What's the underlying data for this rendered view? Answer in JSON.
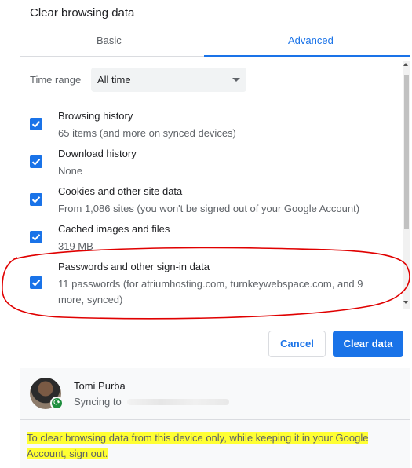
{
  "dialog": {
    "title": "Clear browsing data"
  },
  "tabs": [
    {
      "label": "Basic",
      "active": false
    },
    {
      "label": "Advanced",
      "active": true
    }
  ],
  "time_range": {
    "label": "Time range",
    "value": "All time"
  },
  "items": [
    {
      "title": "Browsing history",
      "subtitle": "65 items (and more on synced devices)",
      "checked": true
    },
    {
      "title": "Download history",
      "subtitle": "None",
      "checked": true
    },
    {
      "title": "Cookies and other site data",
      "subtitle": "From 1,086 sites (you won't be signed out of your Google Account)",
      "checked": true
    },
    {
      "title": "Cached images and files",
      "subtitle": "319 MB",
      "checked": true
    },
    {
      "title": "Passwords and other sign-in data",
      "subtitle": "11 passwords (for atriumhosting.com, turnkeywebspace.com, and 9 more, synced)",
      "checked": true
    }
  ],
  "buttons": {
    "cancel": "Cancel",
    "clear": "Clear data"
  },
  "account": {
    "name": "Tomi Purba",
    "sync_prefix": "Syncing to"
  },
  "footer_note": "To clear browsing data from this device only, while keeping it in your Google Account, sign out.",
  "colors": {
    "accent": "#1a73e8",
    "annotation": "#e00000",
    "highlight": "#ffff33"
  }
}
